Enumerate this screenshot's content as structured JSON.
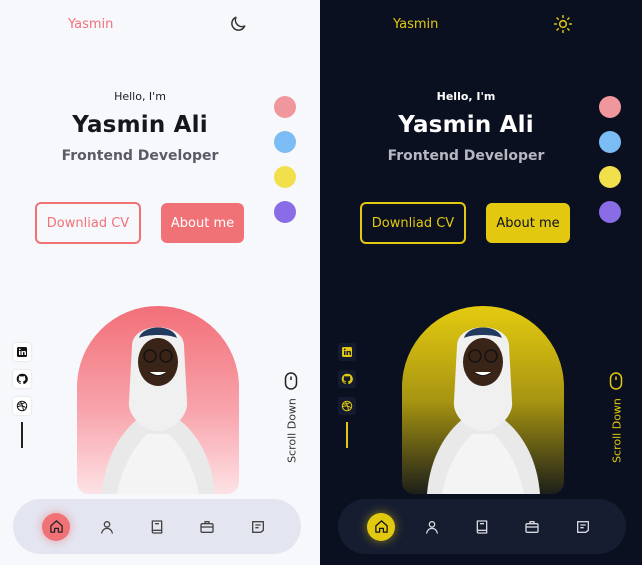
{
  "logo": "Yasmin",
  "hero": {
    "greeting": "Hello, I'm",
    "name": "Yasmin Ali",
    "role": "Frontend Developer"
  },
  "buttons": {
    "download_cv": "Downliad CV",
    "about_me": "About me"
  },
  "scroll_down": "Scroll Down",
  "colors": {
    "light_accent": "#f07277",
    "dark_accent": "#e2c90f",
    "swatches": [
      "#f0979d",
      "#7cbcf5",
      "#f1e04b",
      "#8a6de6"
    ]
  },
  "icons": {
    "theme_light_mode": "moon-icon",
    "theme_dark_mode": "sun-icon",
    "socials": [
      "linkedin-icon",
      "github-icon",
      "dribbble-icon"
    ],
    "nav": [
      "home-icon",
      "user-icon",
      "book-icon",
      "briefcase-icon",
      "message-icon"
    ],
    "scroll": "mouse-icon"
  }
}
